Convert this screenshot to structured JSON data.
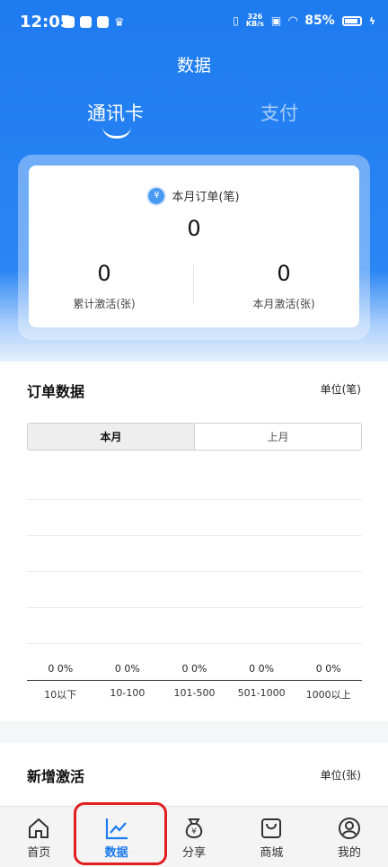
{
  "status_bar": {
    "time": "12:05",
    "net_speed_value": "326",
    "net_speed_unit": "KB/s",
    "battery": "85%"
  },
  "header": {
    "title": "数据"
  },
  "top_tabs": [
    {
      "label": "通讯卡",
      "active": true
    },
    {
      "label": "支付",
      "active": false
    }
  ],
  "summary": {
    "month_orders_label": "本月订单(笔)",
    "month_orders_value": "0",
    "total_activations_label": "累计激活(张)",
    "total_activations_value": "0",
    "month_activations_label": "本月激活(张)",
    "month_activations_value": "0"
  },
  "order_data": {
    "title": "订单数据",
    "unit": "单位(笔)",
    "segments": [
      {
        "label": "本月",
        "active": true
      },
      {
        "label": "上月",
        "active": false
      }
    ]
  },
  "chart_data": {
    "type": "bar",
    "categories": [
      "10以下",
      "10-100",
      "101-500",
      "501-1000",
      "1000以上"
    ],
    "values": [
      0,
      0,
      0,
      0,
      0
    ],
    "percents": [
      "0%",
      "0%",
      "0%",
      "0%",
      "0%"
    ],
    "bar_labels": [
      "0 0%",
      "0 0%",
      "0 0%",
      "0 0%",
      "0 0%"
    ]
  },
  "new_activations": {
    "title": "新增激活",
    "unit": "单位(张)"
  },
  "bottom_nav": [
    {
      "label": "首页",
      "icon": "home-icon",
      "active": false
    },
    {
      "label": "数据",
      "icon": "chart-line-icon",
      "active": true
    },
    {
      "label": "分享",
      "icon": "money-bag-icon",
      "active": false
    },
    {
      "label": "商城",
      "icon": "shopping-bag-icon",
      "active": false
    },
    {
      "label": "我的",
      "icon": "user-icon",
      "active": false
    }
  ],
  "colors": {
    "brand": "#1e7bf0",
    "annotation": "#e02020"
  }
}
